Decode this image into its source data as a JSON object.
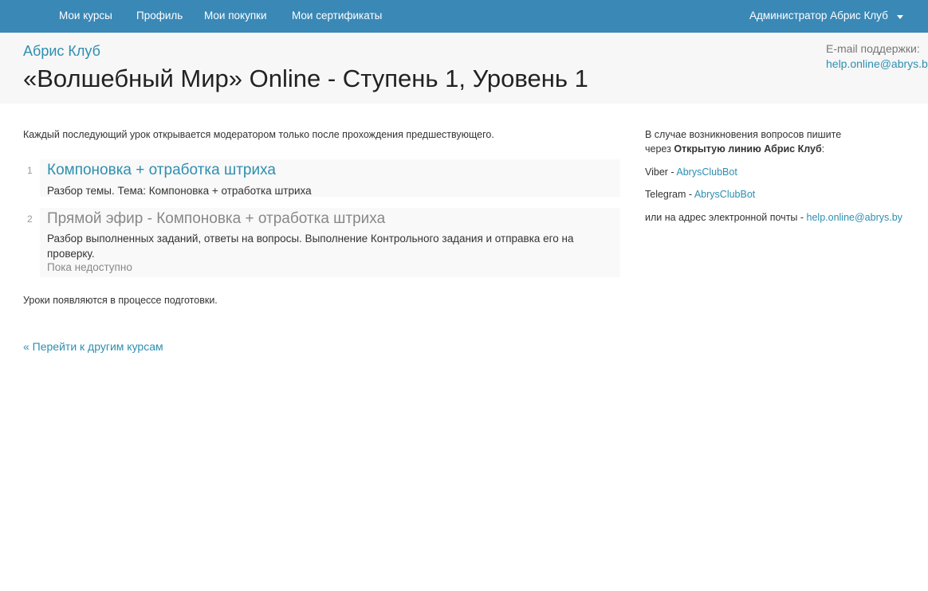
{
  "nav": {
    "items": [
      "Мои курсы",
      "Профиль",
      "Мои покупки",
      "Мои сертификаты"
    ],
    "user": "Администратор Абрис Клуб"
  },
  "header": {
    "club": "Абрис Клуб",
    "title": "«Волшебный Мир» Online - Ступень 1, Уровень 1",
    "support_label": "E-mail поддержки:",
    "support_email": "help.online@abrys.by"
  },
  "main": {
    "intro": "Каждый последующий урок открывается модератором только после прохождения предшествующего.",
    "lessons": [
      {
        "num": "1",
        "title": "Компоновка + отработка штриха",
        "desc": "Разбор темы. Тема: Компоновка + отработка штриха",
        "status": ""
      },
      {
        "num": "2",
        "title": "Прямой эфир - Компоновка + отработка штриха",
        "desc": "Разбор выполненных заданий, ответы на вопросы. Выполнение Контрольного задания и отправка его на проверку.",
        "status": "Пока недоступно"
      }
    ],
    "prep": "Уроки появляются в процессе подготовки.",
    "back_link": "« Перейти к другим курсам"
  },
  "sidebar": {
    "line1": "В случае возникновения вопросов пишите",
    "line2_prefix": "через ",
    "line2_bold": "Открытую линию Абрис Клуб",
    "line2_suffix": ":",
    "viber_label": "Viber - ",
    "viber_link": "AbrysClubBot",
    "telegram_label": "Telegram - ",
    "telegram_link": "AbrysClubBot",
    "email_label": "или на адрес электронной почты - ",
    "email_link": "help.online@abrys.by"
  }
}
